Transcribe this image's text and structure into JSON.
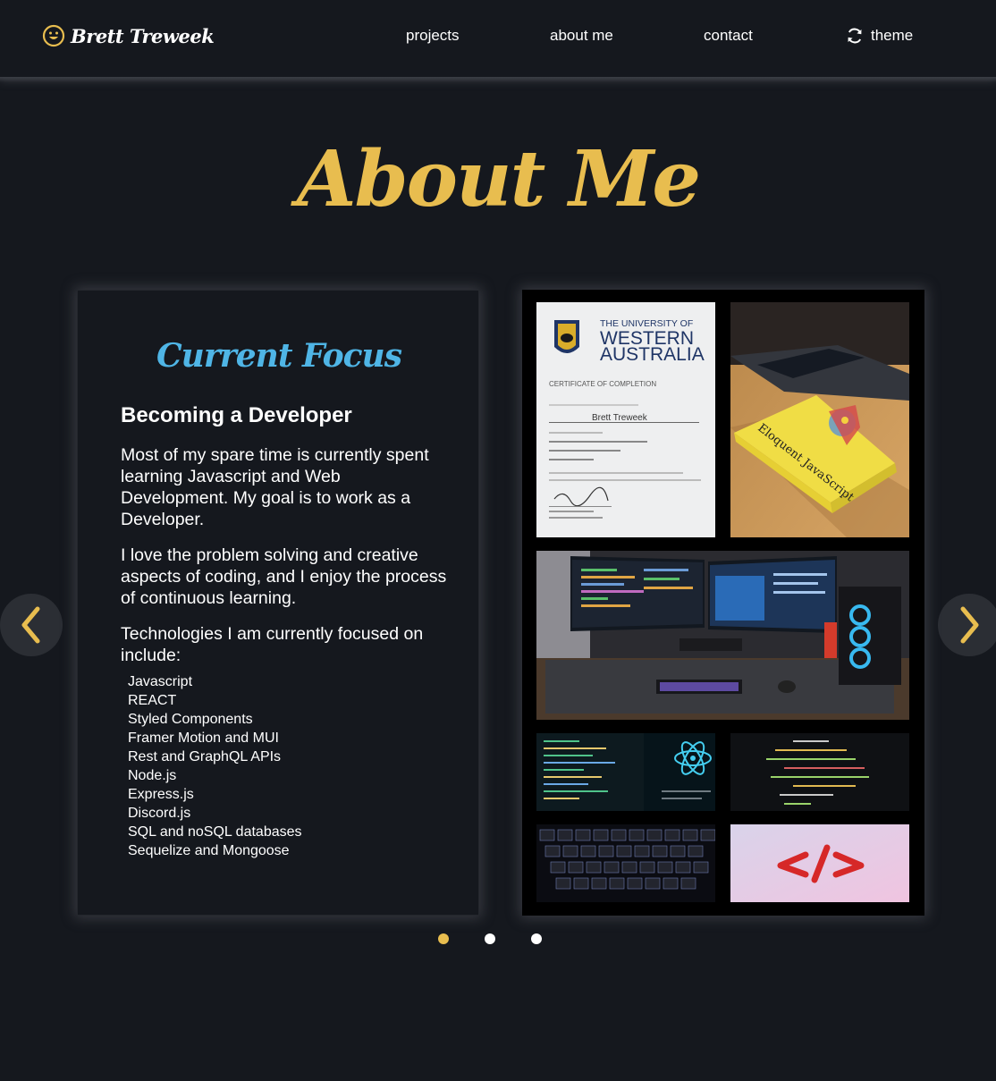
{
  "header": {
    "logo_text": "Brett Treweek",
    "nav": {
      "projects": "projects",
      "about": "about me",
      "contact": "contact",
      "theme": "theme"
    }
  },
  "page": {
    "title": "About Me"
  },
  "card": {
    "heading": "Current Focus",
    "subheading": "Becoming a Developer",
    "paragraphs": [
      "Most of my spare time is currently spent learning Javascript and Web Development. My goal is to work as a Developer.",
      "I love the problem solving and creative aspects of coding, and I enjoy the process of continuous learning.",
      "Technologies I am currently focused on include:"
    ],
    "technologies": [
      "Javascript",
      "REACT",
      "Styled Components",
      "Framer Motion and MUI",
      "Rest and GraphQL APIs",
      "Node.js",
      "Express.js",
      "Discord.js",
      "SQL and noSQL databases",
      "Sequelize and Mongoose"
    ]
  },
  "collage": {
    "certificate": {
      "university_line1": "THE UNIVERSITY OF",
      "university_line2": "WESTERN",
      "university_line3": "AUSTRALIA",
      "cert_title": "CERTIFICATE OF COMPLETION",
      "recipient": "Brett Treweek"
    },
    "book_title": "Eloquent JavaScript"
  },
  "carousel": {
    "slide_count": 3,
    "active_slide": 1
  },
  "colors": {
    "background": "#15181e",
    "accent": "#e8bd4f",
    "heading_blue": "#4fb5e6"
  },
  "icons": {
    "logo": "smiley-face-icon",
    "theme": "refresh-icon",
    "prev": "chevron-left-icon",
    "next": "chevron-right-icon"
  }
}
